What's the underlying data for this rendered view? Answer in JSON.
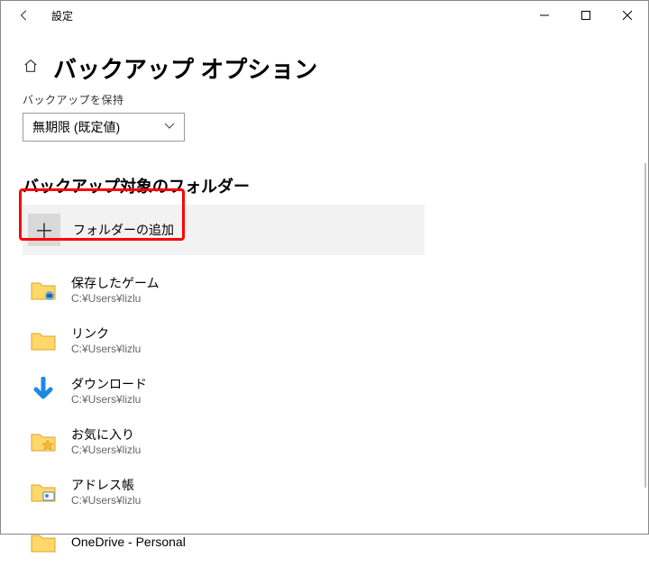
{
  "titlebar": {
    "title": "設定"
  },
  "header": {
    "title": "バックアップ オプション"
  },
  "retention": {
    "label": "バックアップを保持",
    "selected": "無期限 (既定値)"
  },
  "section": {
    "title": "バックアップ対象のフォルダー"
  },
  "add_folder": {
    "label": "フォルダーの追加"
  },
  "folders": [
    {
      "name": "保存したゲーム",
      "path": "C:¥Users¥lizlu",
      "icon": "saved-games"
    },
    {
      "name": "リンク",
      "path": "C:¥Users¥lizlu",
      "icon": "links"
    },
    {
      "name": "ダウンロード",
      "path": "C:¥Users¥lizlu",
      "icon": "downloads"
    },
    {
      "name": "お気に入り",
      "path": "C:¥Users¥lizlu",
      "icon": "favorites"
    },
    {
      "name": "アドレス帳",
      "path": "C:¥Users¥lizlu",
      "icon": "contacts"
    },
    {
      "name": "OneDrive - Personal",
      "path": "",
      "icon": "onedrive"
    }
  ]
}
